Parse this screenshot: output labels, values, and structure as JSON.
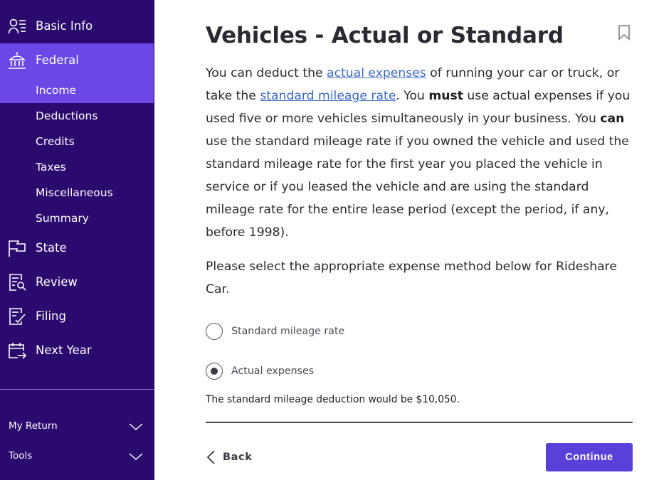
{
  "sidebar": {
    "main_items": [
      {
        "label": "Basic Info",
        "icon": "basic-info-icon"
      },
      {
        "label": "Federal",
        "icon": "federal-building-icon",
        "active": true
      },
      {
        "label": "State",
        "icon": "state-flag-icon"
      },
      {
        "label": "Review",
        "icon": "review-icon"
      },
      {
        "label": "Filing",
        "icon": "filing-icon"
      },
      {
        "label": "Next Year",
        "icon": "next-year-calendar-icon"
      }
    ],
    "sub_items": [
      {
        "label": "Income",
        "active": true
      },
      {
        "label": "Deductions"
      },
      {
        "label": "Credits"
      },
      {
        "label": "Taxes"
      },
      {
        "label": "Miscellaneous"
      },
      {
        "label": "Summary"
      }
    ],
    "my_return_label": "My Return",
    "tools_label": "Tools"
  },
  "page": {
    "title": "Vehicles - Actual or Standard",
    "intro": {
      "t1": "You can deduct the ",
      "link1": "actual expenses",
      "t2": " of running your car or truck, or take the ",
      "link2": "standard mileage rate",
      "t3": ". You ",
      "bold1": "must",
      "t4": " use actual expenses if you used five or more vehicles simultaneously in your business. You ",
      "bold2": "can",
      "t5": " use the standard mileage rate if you owned the vehicle and used the standard mileage rate for the first year you placed the vehicle in service or if you leased the vehicle and are using the standard mileage rate for the entire lease period (except the period, if any, before 1998)."
    },
    "instruction": "Please select the appropriate expense method below for Rideshare Car.",
    "options": [
      {
        "label": "Standard mileage rate",
        "selected": false
      },
      {
        "label": "Actual expenses",
        "selected": true
      }
    ],
    "note": "The standard mileage deduction would be $10,050.",
    "back_label": "Back",
    "continue_label": "Continue"
  },
  "colors": {
    "sidebar_bg": "#2a0a6e",
    "sidebar_active": "#6b47e6",
    "accent": "#5b3fd9",
    "link": "#3d6ac7"
  }
}
